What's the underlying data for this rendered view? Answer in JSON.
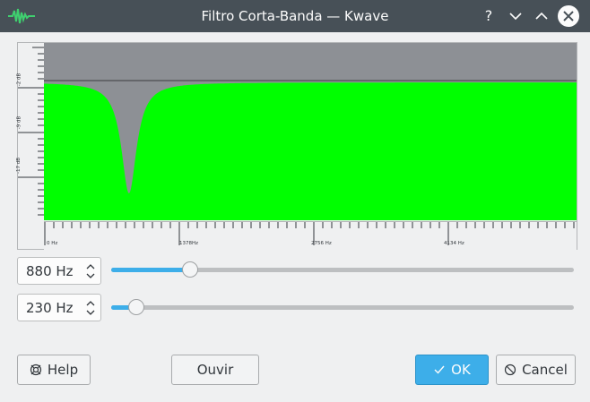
{
  "window": {
    "title": "Filtro Corta-Banda — Kwave",
    "controls": [
      "help-icon",
      "minimize-icon",
      "maximize-icon",
      "close-icon"
    ]
  },
  "chart_data": {
    "type": "area",
    "xlabel": "",
    "ylabel": "",
    "x_ticks": [
      "0 Hz",
      "1378Hz",
      "2756 Hz",
      "4134 Hz"
    ],
    "y_ticks": [
      "-2 dB",
      "-9 dB",
      "-17 dB"
    ],
    "notch_frequency_hz": 880,
    "bandwidth_hz": 230,
    "fill_color": "#00ff00",
    "background_color": "#8d9095"
  },
  "controls": {
    "frequency": {
      "value": "880 Hz",
      "slider_fraction": 0.17
    },
    "bandwidth": {
      "value": "230 Hz",
      "slider_fraction": 0.055
    }
  },
  "buttons": {
    "help": "Help",
    "listen": "Ouvir",
    "ok": "OK",
    "cancel": "Cancel"
  },
  "colors": {
    "accent": "#3daee9",
    "titlebar": "#475057",
    "spectrum": "#00ff00"
  }
}
